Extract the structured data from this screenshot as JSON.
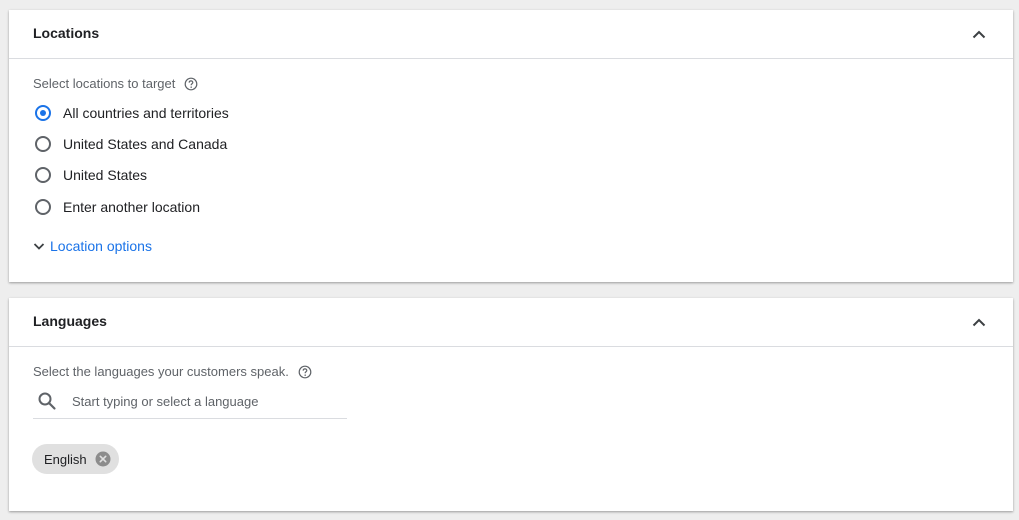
{
  "locations": {
    "title": "Locations",
    "prompt": "Select locations to target",
    "options": [
      {
        "label": "All countries and territories",
        "selected": true
      },
      {
        "label": "United States and Canada",
        "selected": false
      },
      {
        "label": "United States",
        "selected": false
      },
      {
        "label": "Enter another location",
        "selected": false
      }
    ],
    "options_link": "Location options"
  },
  "languages": {
    "title": "Languages",
    "prompt": "Select the languages your customers speak.",
    "search_placeholder": "Start typing or select a language",
    "selected_chips": [
      "English"
    ]
  },
  "colors": {
    "accent": "#1a73e8",
    "background": "#eeeeee",
    "chip": "#e0e0e0"
  }
}
